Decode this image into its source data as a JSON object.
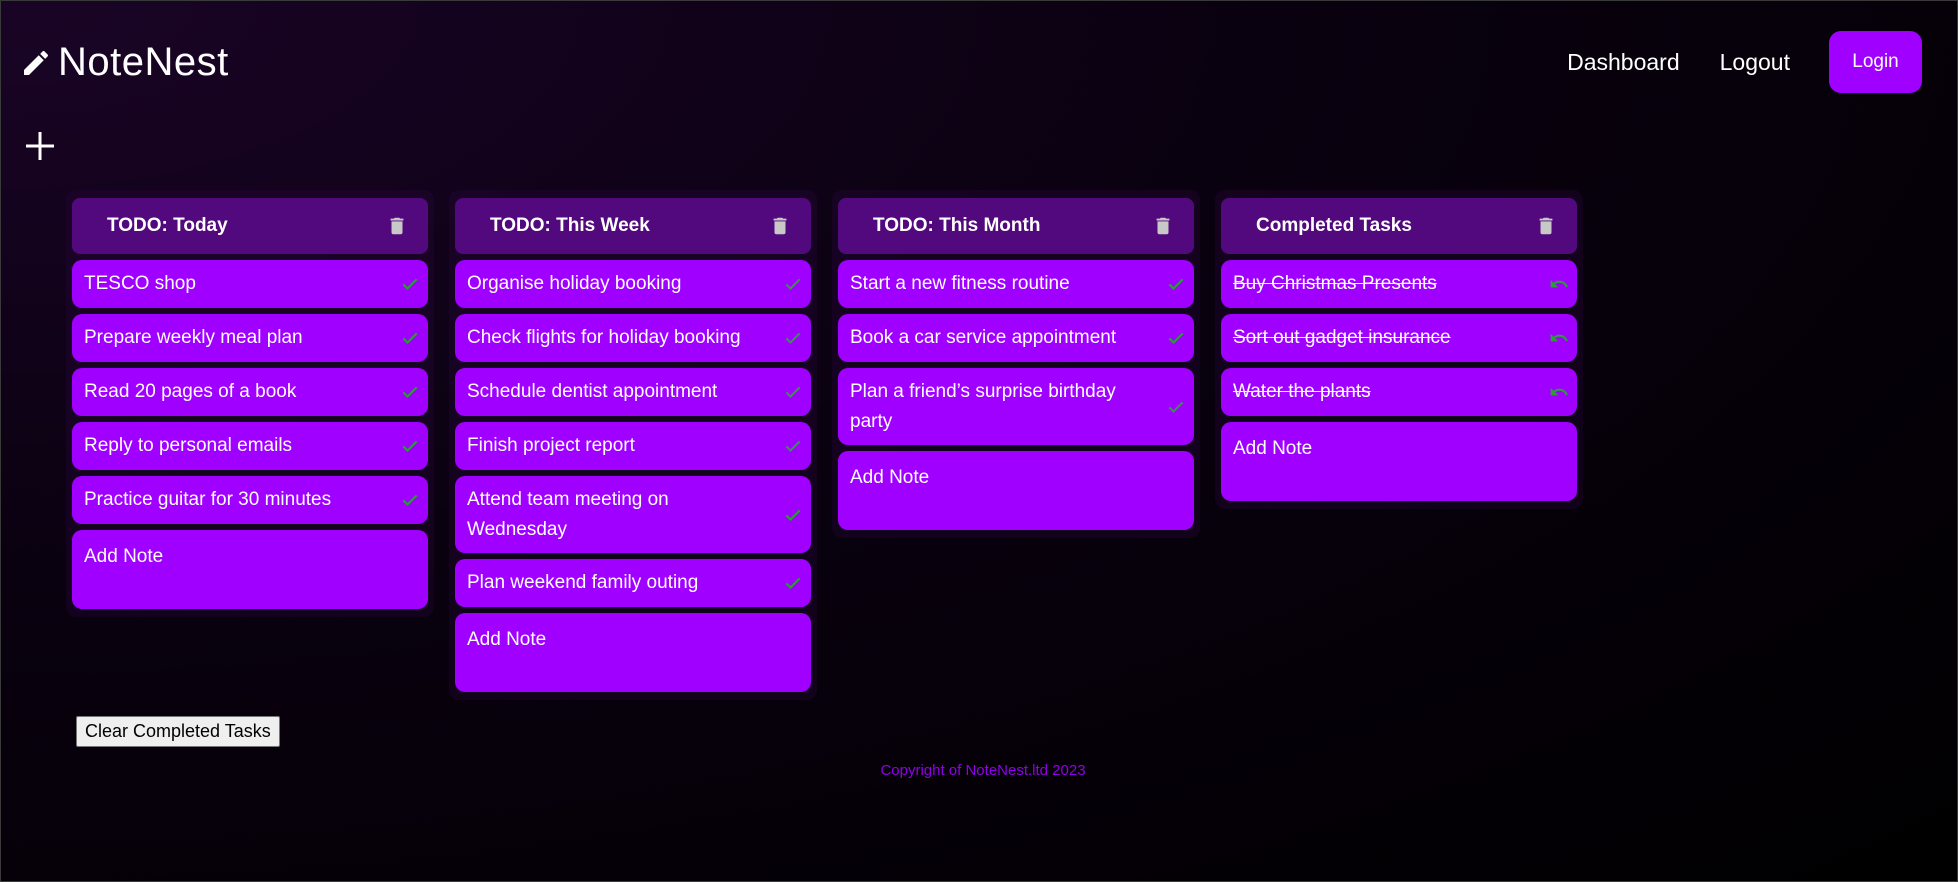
{
  "header": {
    "brand": "NoteNest",
    "nav": {
      "dashboard": "Dashboard",
      "logout": "Logout",
      "login": "Login"
    }
  },
  "colors": {
    "accent": "#a000ff",
    "board_header": "#52097d",
    "check": "#2e9a3a",
    "footer_text": "#9000e8"
  },
  "boards": [
    {
      "title": "TODO: Today",
      "notes": [
        {
          "text": "TESCO shop"
        },
        {
          "text": "Prepare weekly meal plan"
        },
        {
          "text": "Read 20 pages of a book"
        },
        {
          "text": "Reply to personal emails"
        },
        {
          "text": "Practice guitar for 30 minutes"
        }
      ],
      "add_note": "Add Note"
    },
    {
      "title": "TODO: This Week",
      "notes": [
        {
          "text": "Organise holiday booking"
        },
        {
          "text": "Check flights for holiday booking"
        },
        {
          "text": "Schedule dentist appointment"
        },
        {
          "text": "Finish project report"
        },
        {
          "text": "Attend team meeting on Wednesday"
        },
        {
          "text": "Plan weekend family outing"
        }
      ],
      "add_note": "Add Note"
    },
    {
      "title": "TODO: This Month",
      "notes": [
        {
          "text": "Start a new fitness routine"
        },
        {
          "text": "Book a car service appointment"
        },
        {
          "text": "Plan a friend’s surprise birthday party"
        }
      ],
      "add_note": "Add Note"
    },
    {
      "title": "Completed Tasks",
      "notes": [
        {
          "text": "Buy Christmas Presents"
        },
        {
          "text": "Sort out gadget insurance"
        },
        {
          "text": "Water the plants"
        }
      ],
      "add_note": "Add Note"
    }
  ],
  "clear_completed_label": "Clear Completed Tasks",
  "footer": {
    "copyright": "Copyright of NoteNest.ltd 2023"
  }
}
